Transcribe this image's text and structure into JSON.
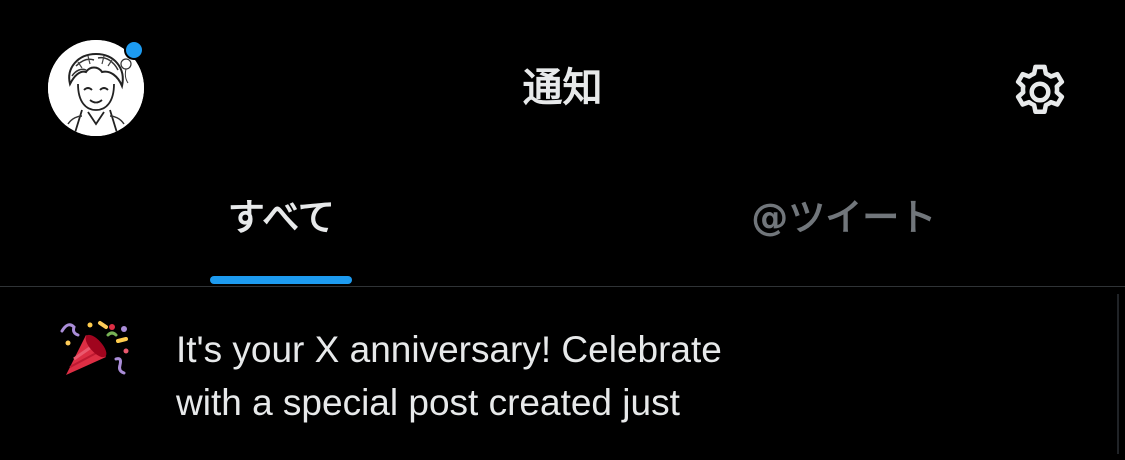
{
  "header": {
    "title": "通知",
    "avatar_alt": "profile-avatar",
    "settings_icon": "gear-icon",
    "colors": {
      "accent": "#1d9bf0",
      "background": "#000000",
      "text_primary": "#e7e9ea",
      "text_secondary": "#71767b"
    }
  },
  "tabs": [
    {
      "label": "すべて",
      "active": true
    },
    {
      "label": "@ツイート",
      "active": false
    }
  ],
  "notifications": [
    {
      "icon": "party-popper-icon",
      "line1": "It's your X anniversary! Celebrate",
      "line2": "with a special post created just"
    }
  ]
}
